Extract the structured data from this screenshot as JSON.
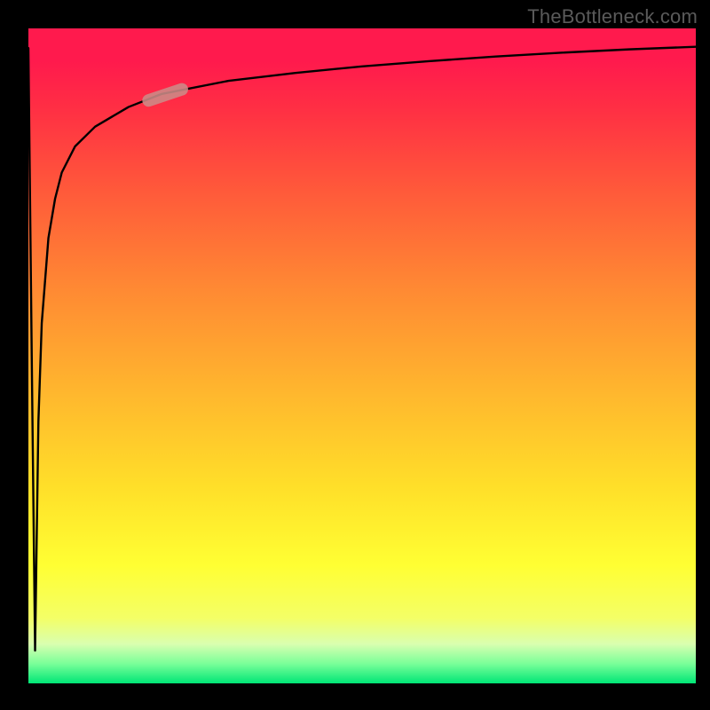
{
  "watermark": {
    "text": "TheBottleneck.com"
  },
  "chart_data": {
    "type": "line",
    "title": "",
    "xlabel": "",
    "ylabel": "",
    "xlim": [
      0,
      100
    ],
    "ylim": [
      0,
      100
    ],
    "grid": false,
    "legend": false,
    "series": [
      {
        "name": "curve",
        "x": [
          0,
          0.5,
          1,
          1.5,
          2,
          3,
          4,
          5,
          7,
          10,
          15,
          20,
          30,
          40,
          50,
          60,
          70,
          80,
          90,
          100
        ],
        "values": [
          97,
          50,
          5,
          40,
          55,
          68,
          74,
          78,
          82,
          85,
          88,
          90,
          92,
          93.2,
          94.2,
          95,
          95.7,
          96.3,
          96.8,
          97.2
        ]
      },
      {
        "name": "highlight-segment",
        "x": [
          18,
          23
        ],
        "values": [
          89,
          90.7
        ]
      }
    ],
    "highlight_color": "#cc8b87",
    "curve_color": "#000000",
    "background_gradient_stops": [
      {
        "pos": 0,
        "color": "#ff1a4d"
      },
      {
        "pos": 0.5,
        "color": "#ffb52e"
      },
      {
        "pos": 0.8,
        "color": "#ffff33"
      },
      {
        "pos": 1,
        "color": "#00e676"
      }
    ]
  }
}
